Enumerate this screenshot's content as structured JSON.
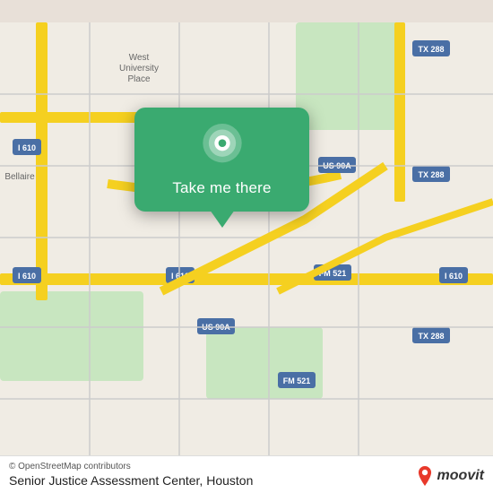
{
  "map": {
    "attribution": "© OpenStreetMap contributors",
    "location_title": "Senior Justice Assessment Center, Houston",
    "bg_color": "#e8e0d8"
  },
  "popup": {
    "button_label": "Take me there",
    "bg_color": "#3aaa70"
  },
  "moovit": {
    "text": "moovit",
    "pin_color": "#e8392b"
  }
}
